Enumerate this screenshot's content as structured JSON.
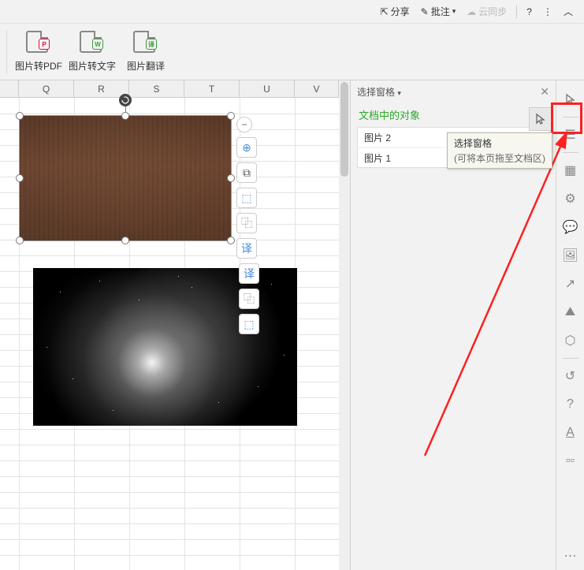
{
  "topbar": {
    "share": "分享",
    "comment": "批注",
    "cloud": "云同步"
  },
  "ribbon": {
    "pdf": "图片转PDF",
    "ocr": "图片转文字",
    "translate": "图片翻译"
  },
  "columns": [
    "Q",
    "R",
    "S",
    "T",
    "U",
    "V"
  ],
  "panel": {
    "title": "选择窗格",
    "subtitle": "文档中的对象",
    "items": [
      "图片 2",
      "图片 1"
    ]
  },
  "tooltip": {
    "title": "选择窗格",
    "desc": "(可将本页拖至文档区)"
  },
  "float_tools": [
    "−",
    "⊕",
    "⧉",
    "⬚",
    "⿻",
    "译"
  ],
  "float_tools2": [
    "译",
    "⿻",
    "⬚"
  ]
}
